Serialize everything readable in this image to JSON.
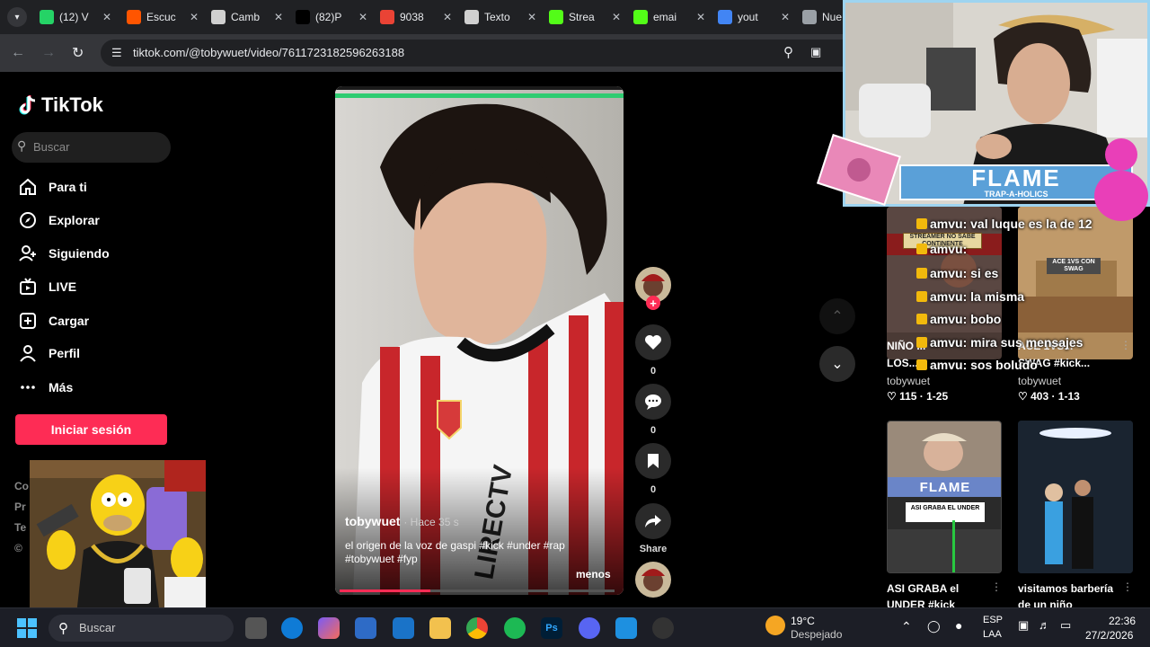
{
  "browser": {
    "tabs": [
      {
        "title": "(12) V",
        "icon": "whatsapp-icon",
        "color": "#25d366"
      },
      {
        "title": "Escuc",
        "icon": "soundcloud-icon",
        "color": "#ff5500"
      },
      {
        "title": "Camb",
        "icon": "chatgpt-icon",
        "color": "#d0d0d0"
      },
      {
        "title": "(82)P",
        "icon": "tiktok-icon",
        "color": "#000000"
      },
      {
        "title": "9038",
        "icon": "gmail-icon",
        "color": "#ea4335"
      },
      {
        "title": "Texto",
        "icon": "chatgpt-icon",
        "color": "#d0d0d0"
      },
      {
        "title": "Strea",
        "icon": "kick-icon",
        "color": "#53fc18"
      },
      {
        "title": "emai",
        "icon": "kick-icon",
        "color": "#53fc18"
      },
      {
        "title": "yout",
        "icon": "google-icon",
        "color": "#4285f4"
      },
      {
        "title": "Nue",
        "icon": "chrome-icon",
        "color": "#9aa0a6"
      }
    ],
    "url": "tiktok.com/@tobywuet/video/7611723182596263188"
  },
  "tiktok": {
    "logo": "TikTok",
    "search_placeholder": "Buscar",
    "nav": [
      {
        "label": "Para ti",
        "icon": "home-icon"
      },
      {
        "label": "Explorar",
        "icon": "compass-icon"
      },
      {
        "label": "Siguiendo",
        "icon": "following-icon"
      },
      {
        "label": "LIVE",
        "icon": "live-icon"
      },
      {
        "label": "Cargar",
        "icon": "upload-icon"
      },
      {
        "label": "Perfil",
        "icon": "profile-icon"
      },
      {
        "label": "Más",
        "icon": "more-icon"
      }
    ],
    "login_button": "Iniciar sesión",
    "footer_fragments": [
      "Co",
      "Pr",
      "Te",
      "© "
    ],
    "accent": "#fe2c55"
  },
  "video": {
    "author": "tobywuet",
    "time": "· Hace 35 s",
    "caption": "el origen de la voz de gaspi #kick #under #rap #tobywuet #fyp",
    "less": "menos",
    "likes": "0",
    "comments": "0",
    "saves": "0",
    "share": "Share",
    "progress": 0.33
  },
  "related": [
    {
      "title": "NIÑO ...",
      "title2": "LOS...",
      "author": "tobywuet",
      "stats": "♡ 115 · 1-25"
    },
    {
      "title": "ACE 1VS...",
      "title2": "SWAG #kick...",
      "author": "tobywuet",
      "stats": "♡ 403 · 1-13"
    },
    {
      "title": "ASI GRABA el",
      "title2": "UNDER #kick",
      "thumb_text": "ASI GRABA EL UNDER",
      "author": "",
      "stats": ""
    },
    {
      "title": "visitamos barbería",
      "title2": "de un niño",
      "author": "",
      "stats": ""
    }
  ],
  "stream_overlay": {
    "banner": "FLAME",
    "banner_sub": "TRAP-A-HOLICS",
    "thumb_banner": "FLAME",
    "streamer_tag": "STREAMER NO SABE CONTINENTE",
    "ace_tag": "ACE 1VS CON SWAG",
    "chat": [
      {
        "user": "amvu",
        "msg": "val luque es la de 12"
      },
      {
        "user": "amvu",
        "msg": ""
      },
      {
        "user": "amvu",
        "msg": "si es"
      },
      {
        "user": "amvu",
        "msg": "la misma"
      },
      {
        "user": "amvu",
        "msg": "bobo"
      },
      {
        "user": "amvu",
        "msg": "mira sus mensajes"
      },
      {
        "user": "amvu",
        "msg": "sos boludo"
      }
    ]
  },
  "taskbar": {
    "search": "Buscar",
    "weather_temp": "19°C",
    "weather_desc": "Despejado",
    "lang": "ESP",
    "lang2": "LAA",
    "time": "22:36",
    "date": "27/2/2026"
  }
}
